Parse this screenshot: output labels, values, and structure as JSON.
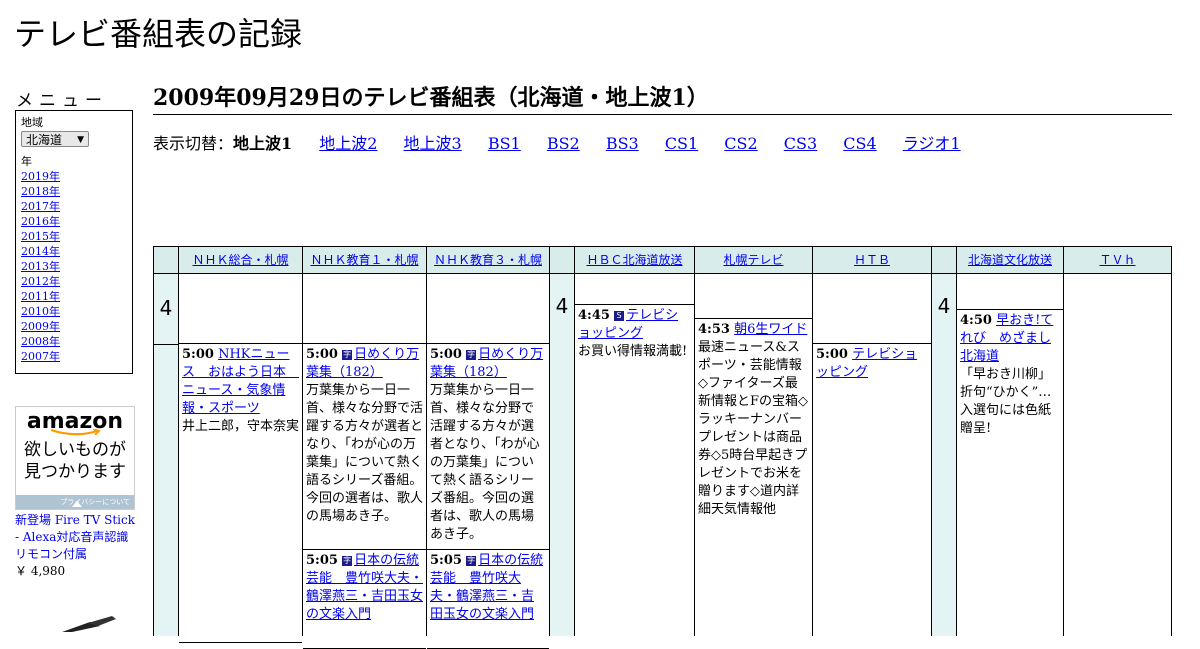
{
  "site_title": "テレビ番組表の記録",
  "sidebar": {
    "menu_heading": "メニュー",
    "region_label": "地域",
    "region_value": "北海道",
    "year_label": "年",
    "years": [
      "2019年",
      "2018年",
      "2017年",
      "2016年",
      "2015年",
      "2014年",
      "2013年",
      "2012年",
      "2011年",
      "2010年",
      "2009年",
      "2008年",
      "2007年"
    ]
  },
  "ad": {
    "logo": "amazon",
    "tagline_1": "欲しいものが",
    "tagline_2": "見つかります",
    "privacy": "プライバシーについて",
    "product": "新登場 Fire TV Stick - Alexa対応音声認識リモコン付属",
    "price": "￥ 4,980"
  },
  "page_heading": "2009年09月29日のテレビ番組表（北海道・地上波1）",
  "view_switch": {
    "label": "表示切替：",
    "current": "地上波1",
    "links": [
      "地上波2",
      "地上波3",
      "BS1",
      "BS2",
      "BS3",
      "CS1",
      "CS2",
      "CS3",
      "CS4",
      "ラジオ1"
    ]
  },
  "hour": "4",
  "channels": [
    {
      "name": "ＮＨＫ総合・札幌"
    },
    {
      "name": "ＮＨＫ教育１・札幌"
    },
    {
      "name": "ＮＨＫ教育３・札幌"
    },
    {
      "name": "ＨＢＣ北海道放送"
    },
    {
      "name": "札幌テレビ"
    },
    {
      "name": "ＨＴＢ"
    },
    {
      "name": "北海道文化放送"
    },
    {
      "name": "ＴＶｈ"
    }
  ],
  "programs": {
    "nhk_sogo_1": {
      "time": "5:00",
      "title": "NHKニュース　おはよう日本　ニュース・気象情報・スポーツ",
      "desc": "井上二郎，守本奈実"
    },
    "nhk_e1_1": {
      "time": "5:00",
      "icon": "字",
      "title": "日めくり万葉集（182）",
      "desc": "万葉集から一日一首、様々な分野で活躍する方々が選者となり、「わが心の万葉集」について熱く語るシリーズ番組。今回の選者は、歌人の馬場あき子。"
    },
    "nhk_e1_2": {
      "time": "5:05",
      "icon": "字",
      "title": "日本の伝統芸能　豊竹咲大夫・鶴澤燕三・吉田玉女の文楽入門"
    },
    "nhk_e3_1": {
      "time": "5:00",
      "icon": "字",
      "title": "日めくり万葉集（182）",
      "desc": "万葉集から一日一首、様々な分野で活躍する方々が選者となり、「わが心の万葉集」について熱く語るシリーズ番組。今回の選者は、歌人の馬場あき子。"
    },
    "nhk_e3_2": {
      "time": "5:05",
      "icon": "字",
      "title": "日本の伝統芸能　豊竹咲大夫・鶴澤燕三・吉田玉女の文楽入門"
    },
    "hbc_1": {
      "time": "4:45",
      "icon": "S",
      "title": "テレビショッピング",
      "desc": "お買い得情報満載!"
    },
    "stv_1": {
      "time": "4:53",
      "title": "朝6生ワイド",
      "desc": "最速ニュース&スポーツ・芸能情報◇ファイターズ最新情報とFの宝箱◇ラッキーナンバープレゼントは商品券◇5時台早起きプレゼントでお米を贈ります◇道内詳細天気情報他"
    },
    "htb_1": {
      "time": "5:00",
      "title": "テレビショッピング"
    },
    "uhb_1": {
      "time": "4:50",
      "title": "早おき!てれび　めざまし北海道",
      "desc": "「早おき川柳」折句“ひかく”…入選句には色紙贈呈!"
    }
  }
}
